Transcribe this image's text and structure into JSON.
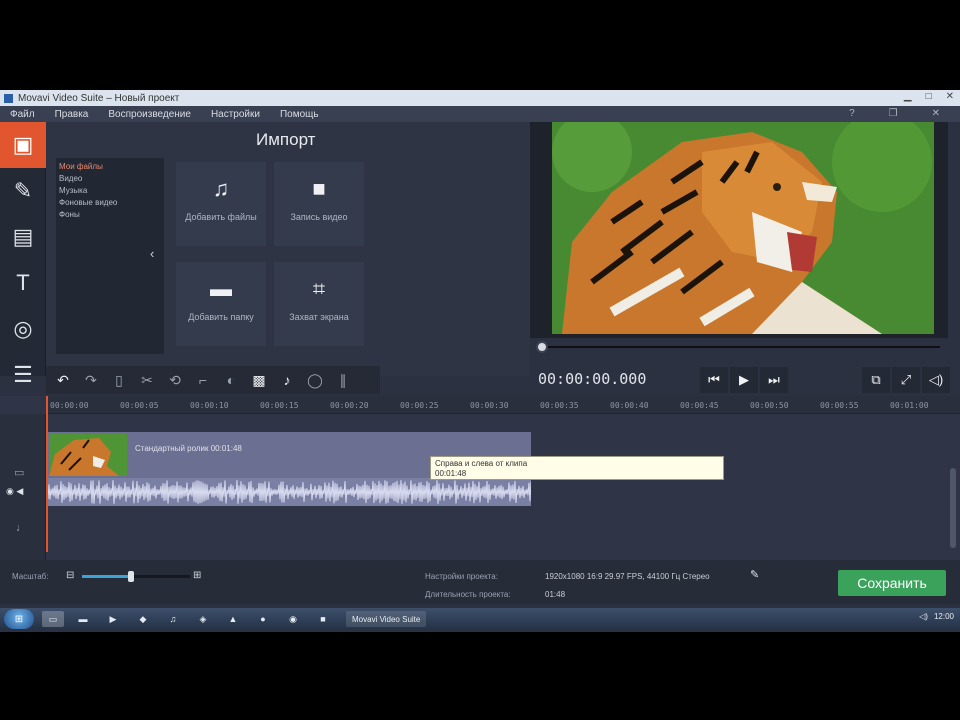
{
  "window": {
    "title": "Movavi Video Suite – Новый проект"
  },
  "menu": {
    "items": [
      "Файл",
      "Правка",
      "Воспроизведение",
      "Настройки",
      "Помощь"
    ]
  },
  "import": {
    "title": "Импорт",
    "categories": [
      "Мои файлы",
      "Видео",
      "Музыка",
      "Фоновые видео",
      "Фоны"
    ],
    "tiles": [
      {
        "label": "Добавить файлы",
        "icon": "add-files-icon"
      },
      {
        "label": "Запись видео",
        "icon": "camera-icon"
      },
      {
        "label": "Добавить папку",
        "icon": "folder-icon"
      },
      {
        "label": "Захват экрана",
        "icon": "screen-capture-icon"
      }
    ]
  },
  "player": {
    "timecode": "00:00:00.000",
    "position": 0
  },
  "timeline": {
    "ruler": [
      "00:00:00",
      "00:00:05",
      "00:00:10",
      "00:00:15",
      "00:00:20",
      "00:00:25",
      "00:00:30",
      "00:00:35",
      "00:00:40",
      "00:00:45",
      "00:00:50",
      "00:00:55",
      "00:01:00"
    ],
    "clip_title": "Стандартный ролик 00:01:48",
    "tooltip_line1": "Справа и слева от клипа",
    "tooltip_line2": "00:01:48"
  },
  "status": {
    "zoom_label": "Масштаб:",
    "zoom_level": 0.45,
    "settings_label": "Настройки проекта:",
    "settings_value": "1920x1080 16:9 29.97 FPS, 44100 Гц Стерео",
    "duration_label": "Длительность проекта:",
    "duration_value": "01:48"
  },
  "save_button": "Сохранить",
  "taskbar": {
    "task_label": "Movavi Video Suite",
    "clock": "12:00"
  },
  "colors": {
    "accent": "#e1562f",
    "save": "#3aa25a",
    "panel": "#2b3140"
  }
}
